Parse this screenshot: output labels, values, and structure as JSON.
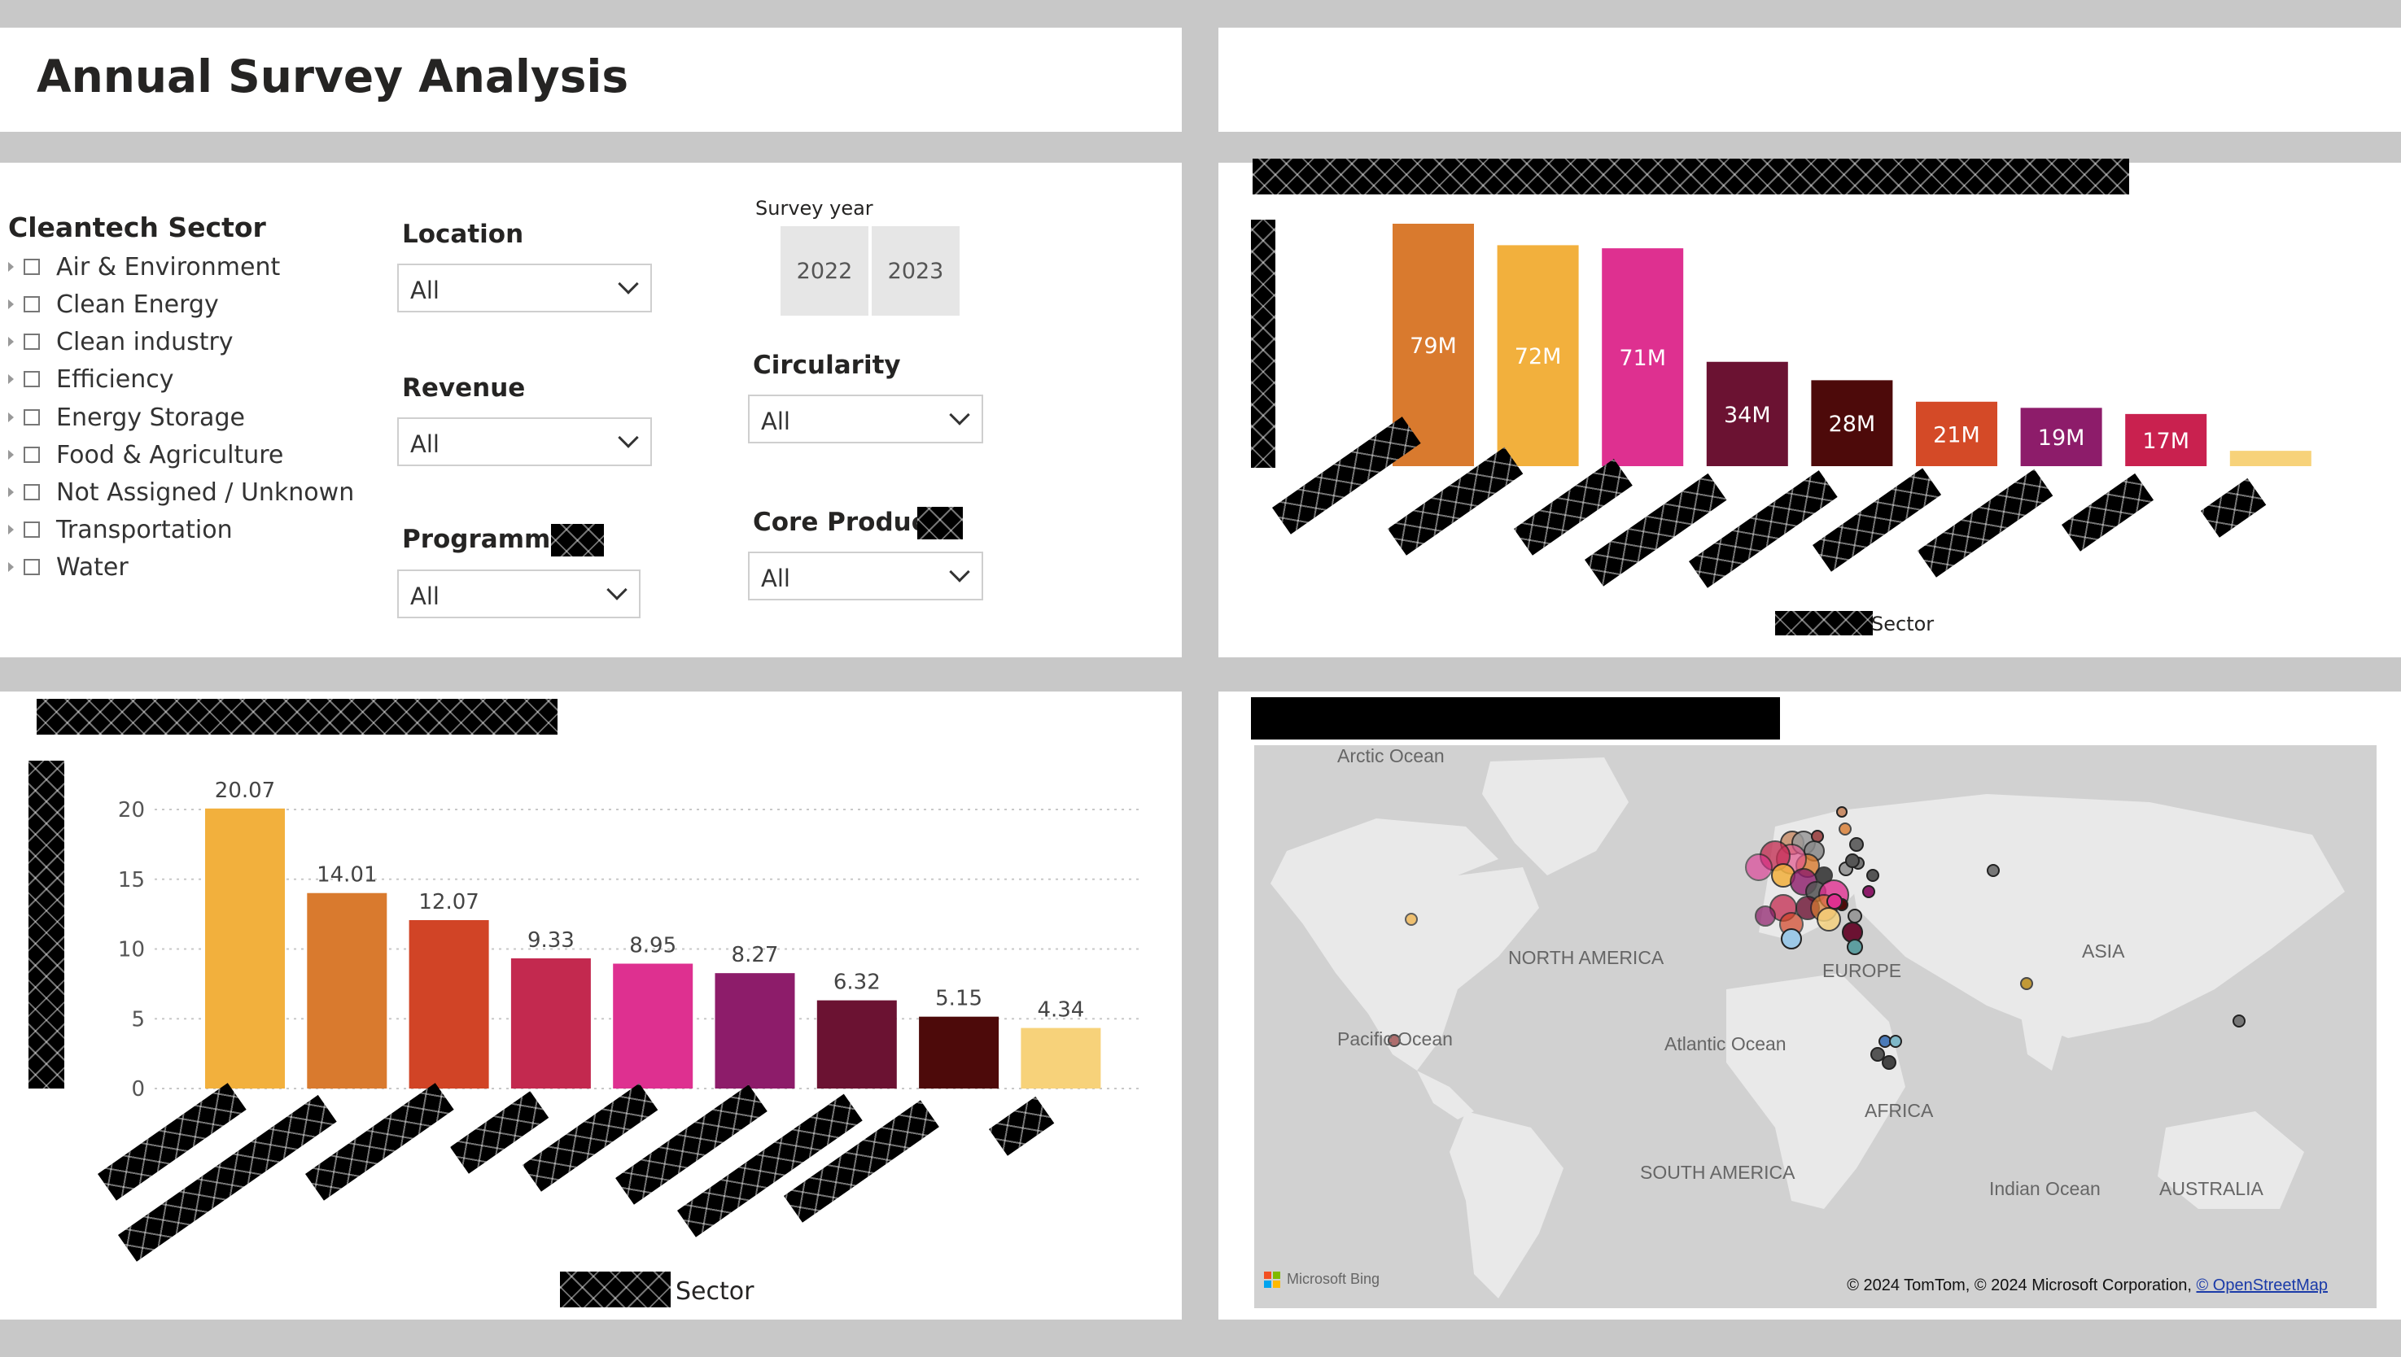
{
  "header": {
    "title": "Annual Survey Analysis"
  },
  "filters": {
    "sector": {
      "title": "Cleantech Sector",
      "items": [
        "Air & Environment",
        "Clean Energy",
        "Clean industry",
        "Efficiency",
        "Energy Storage",
        "Food & Agriculture",
        "Not Assigned / Unknown",
        "Transportation",
        "Water"
      ]
    },
    "location": {
      "label": "Location",
      "value": "All"
    },
    "revenue": {
      "label": "Revenue",
      "value": "All"
    },
    "programme": {
      "label": "Programme",
      "value": "All"
    },
    "survey_year": {
      "label": "Survey year",
      "options": [
        "2022",
        "2023"
      ]
    },
    "circularity": {
      "label": "Circularity",
      "value": "All"
    },
    "core_product": {
      "label": "Core Product",
      "value": "All"
    }
  },
  "chart_data": [
    {
      "type": "bar",
      "series": [
        {
          "values": [
            79,
            72,
            71,
            34,
            28,
            21,
            19,
            17,
            5
          ]
        }
      ],
      "data_labels": [
        "79M",
        "72M",
        "71M",
        "34M",
        "28M",
        "21M",
        "19M",
        "17M",
        ""
      ],
      "colors": [
        "#d97a2e",
        "#f2b03d",
        "#de3090",
        "#6b1232",
        "#4d0a0a",
        "#d44a27",
        "#8d1c6a",
        "#c9214f",
        "#f7d27a"
      ],
      "xlabel": "Sector",
      "grid": false
    },
    {
      "type": "bar",
      "series": [
        {
          "values": [
            20.07,
            14.01,
            12.07,
            9.33,
            8.95,
            8.27,
            6.32,
            5.15,
            4.34
          ]
        }
      ],
      "data_labels": [
        "20.07",
        "14.01",
        "12.07",
        "9.33",
        "8.95",
        "8.27",
        "6.32",
        "5.15",
        "4.34"
      ],
      "colors": [
        "#f2b03d",
        "#d97a2e",
        "#d14426",
        "#c3294f",
        "#de3090",
        "#8d1c6a",
        "#6b1232",
        "#4d0a0a",
        "#f7d27a"
      ],
      "yticks": [
        "0",
        "5",
        "10",
        "15",
        "20"
      ],
      "ylim": [
        0,
        20.5
      ],
      "xlabel": "Sector",
      "grid": true
    }
  ],
  "map": {
    "labels": {
      "arctic": "Arctic Ocean",
      "north_america": "NORTH AMERICA",
      "europe": "EUROPE",
      "asia": "ASIA",
      "pacific": "Pacific Ocean",
      "atlantic": "Atlantic Ocean",
      "africa": "AFRICA",
      "south_america": "SOUTH AMERICA",
      "indian": "Indian Ocean",
      "australia": "AUSTRALIA"
    },
    "logo": "Microsoft Bing",
    "copyright": "© 2024 TomTom, © 2024 Microsoft Corporation,",
    "osm_link": "© OpenStreetMap"
  }
}
